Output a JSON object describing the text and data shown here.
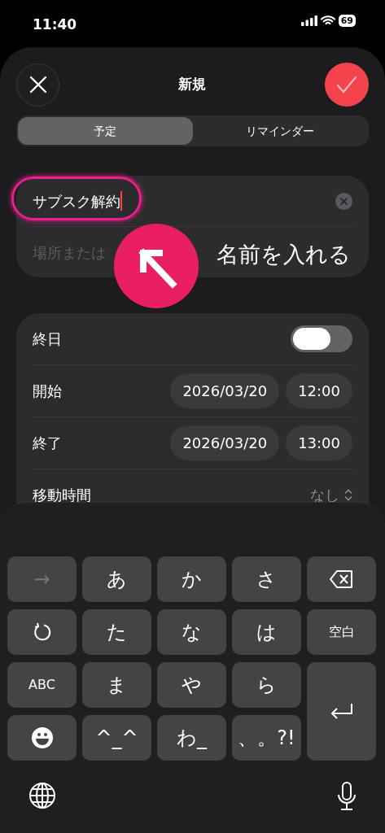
{
  "status_bar": {
    "time": "11:40",
    "battery": "69"
  },
  "header": {
    "title": "新規"
  },
  "segments": [
    {
      "label": "予定",
      "selected": true
    },
    {
      "label": "リマインダー",
      "selected": false
    }
  ],
  "title_field": {
    "value": "サブスク解約"
  },
  "location_field": {
    "placeholder": "場所または"
  },
  "annotation": {
    "text": "名前を入れる"
  },
  "rows": [
    {
      "kind": "toggle",
      "label": "終日",
      "on": false
    },
    {
      "kind": "datetime",
      "label": "開始",
      "date": "2026/03/20",
      "time": "12:00"
    },
    {
      "kind": "datetime",
      "label": "終了",
      "date": "2026/03/20",
      "time": "13:00"
    },
    {
      "kind": "picker",
      "label": "移動時間",
      "value": "なし"
    }
  ],
  "keyboard": {
    "keys": [
      {
        "kind": "char",
        "label": "→",
        "disabled": true
      },
      {
        "kind": "char",
        "label": "あ",
        "disabled": false
      },
      {
        "kind": "char",
        "label": "か",
        "disabled": false
      },
      {
        "kind": "char",
        "label": "さ",
        "disabled": false
      },
      {
        "kind": "backspace",
        "disabled": false
      },
      {
        "kind": "undo",
        "disabled": false
      },
      {
        "kind": "char",
        "label": "た",
        "disabled": false
      },
      {
        "kind": "char",
        "label": "な",
        "disabled": false
      },
      {
        "kind": "char",
        "label": "は",
        "disabled": false
      },
      {
        "kind": "small",
        "label": "空白",
        "disabled": false
      },
      {
        "kind": "small",
        "label": "ABC",
        "disabled": false
      },
      {
        "kind": "char",
        "label": "ま",
        "disabled": false
      },
      {
        "kind": "char",
        "label": "や",
        "disabled": false
      },
      {
        "kind": "char",
        "label": "ら",
        "disabled": false
      },
      {
        "kind": "enter",
        "disabled": false
      },
      {
        "kind": "emoji",
        "disabled": false
      },
      {
        "kind": "char",
        "label": "^_^",
        "disabled": false
      },
      {
        "kind": "char",
        "label": "わ_",
        "disabled": false
      },
      {
        "kind": "char",
        "label": "、。?!",
        "disabled": false
      }
    ]
  }
}
